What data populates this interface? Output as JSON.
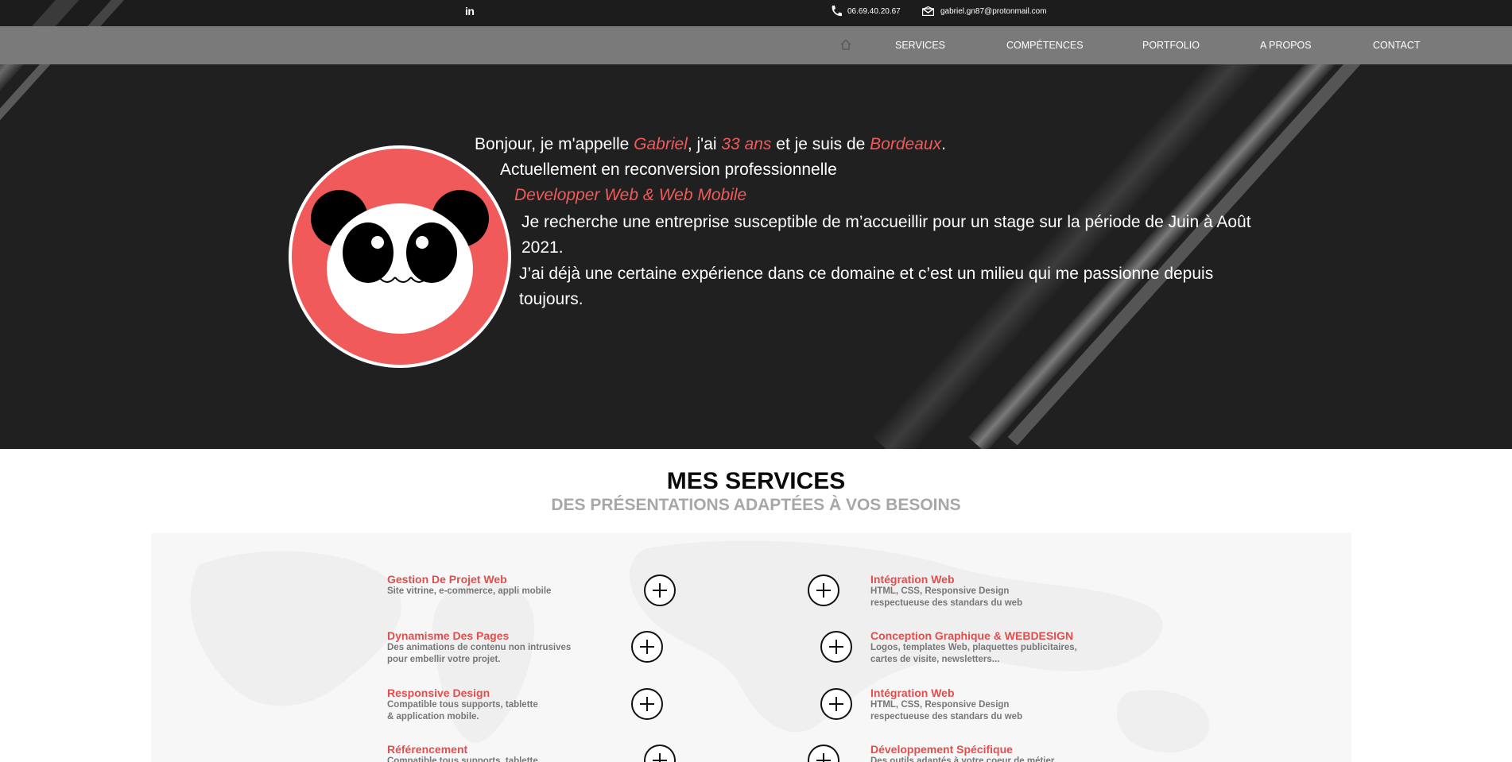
{
  "topbar": {
    "linkedin_label": "in",
    "phone": "06.69.40.20.67",
    "email": "gabriel.gn87@protonmail.com"
  },
  "nav": {
    "items": [
      {
        "label": "SERVICES"
      },
      {
        "label": "COMPÉTENCES"
      },
      {
        "label": "PORTFOLIO"
      },
      {
        "label": "A PROPOS"
      },
      {
        "label": "CONTACT"
      }
    ]
  },
  "hero": {
    "intro_1": "Bonjour, je m'appelle ",
    "name": "Gabriel",
    "intro_2": ", j'ai ",
    "age": "33 ans",
    "intro_3": " et je suis de ",
    "city": "Bordeaux",
    "intro_4": ".",
    "line2": "Actuellement en reconversion professionnelle",
    "line3": "Developper Web & Web Mobile",
    "para1": "Je recherche une entreprise susceptible de m’accueillir pour un stage sur la période de Juin à Août 2021.",
    "para2": "J’ai déjà une certaine expérience dans ce domaine et c’est un milieu qui me passionne depuis toujours."
  },
  "services": {
    "title": "MES SERVICES",
    "subtitle": "DES PRÉSENTATIONS ADAPTÉES À VOS BESOINS",
    "left": [
      {
        "title": "Gestion De Projet Web",
        "desc": "Site vitrine, e-commerce, appli mobile"
      },
      {
        "title": "Dynamisme Des Pages",
        "desc": "Des animations de contenu non intrusives\npour embellir votre projet."
      },
      {
        "title": "Responsive Design",
        "desc": "Compatible tous supports, tablette\n& application mobile."
      },
      {
        "title": "Référencement",
        "desc": "Compatible tous supports, tablette"
      }
    ],
    "right": [
      {
        "title": "Intégration Web",
        "desc": "HTML, CSS, Responsive Design\nrespectueuse des standars du web"
      },
      {
        "title": "Conception Graphique & WEBDESIGN",
        "desc": "Logos, templates Web, plaquettes publicitaires,\ncartes de visite, newsletters..."
      },
      {
        "title": "Intégration Web",
        "desc": "HTML, CSS, Responsive Design\nrespectueuse des standars du web"
      },
      {
        "title": "Développement Spécifique",
        "desc": "Des outils adaptés à votre coeur de métier"
      }
    ]
  },
  "colors": {
    "accent": "#e24d4d",
    "hero_bg": "#202020",
    "nav_bg": "#7a7a7a",
    "avatar_red": "#f05a5a"
  }
}
